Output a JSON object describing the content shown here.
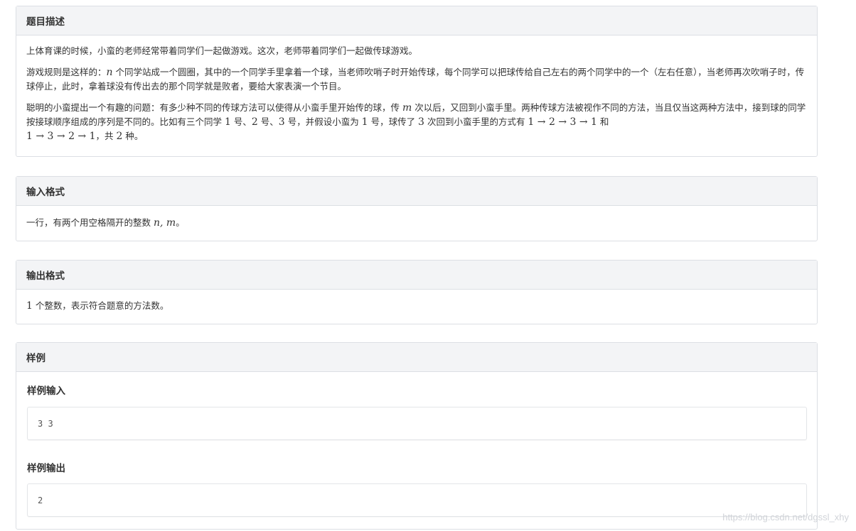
{
  "description": {
    "heading": "题目描述",
    "p1": "上体育课的时候，小蛮的老师经常带着同学们一起做游戏。这次，老师带着同学们一起做传球游戏。",
    "p2_a": "游戏规则是这样的：",
    "p2_n": "n",
    "p2_b": " 个同学站成一个圆圈，其中的一个同学手里拿着一个球，当老师吹哨子时开始传球，每个同学可以把球传给自己左右的两个同学中的一个（左右任意），当老师再次吹哨子时，传球停止，此时，拿着球没有传出去的那个同学就是败者，要给大家表演一个节目。",
    "p3_a": "聪明的小蛮提出一个有趣的问题：有多少种不同的传球方法可以使得从小蛮手里开始传的球，传 ",
    "p3_m": "m",
    "p3_b": " 次以后，又回到小蛮手里。两种传球方法被视作不同的方法，当且仅当这两种方法中，接到球的同学按接球顺序组成的序列是不同的。比如有三个同学 ",
    "p3_1": "1",
    "p3_c": " 号、",
    "p3_2": "2",
    "p3_d": " 号、",
    "p3_3": "3",
    "p3_e": " 号，并假设小蛮为 ",
    "p3_4": "1",
    "p3_f": " 号，球传了 ",
    "p3_5": "3",
    "p3_g": " 次回到小蛮手里的方式有 ",
    "p3_seq1": "1 → 2 → 3 → 1",
    "p3_h": " 和",
    "p3_seq2": "1 → 3 → 2 → 1",
    "p3_i": "，共 ",
    "p3_6": "2",
    "p3_j": " 种。"
  },
  "input_format": {
    "heading": "输入格式",
    "text_a": "一行，有两个用空格隔开的整数 ",
    "vars": "n, m",
    "text_b": "。"
  },
  "output_format": {
    "heading": "输出格式",
    "num": "1",
    "text": " 个整数，表示符合题意的方法数。"
  },
  "sample": {
    "heading": "样例",
    "input_title": "样例输入",
    "input_value": "3 3",
    "output_title": "样例输出",
    "output_value": "2"
  },
  "watermark": "https://blog.csdn.net/dgssl_xhy"
}
